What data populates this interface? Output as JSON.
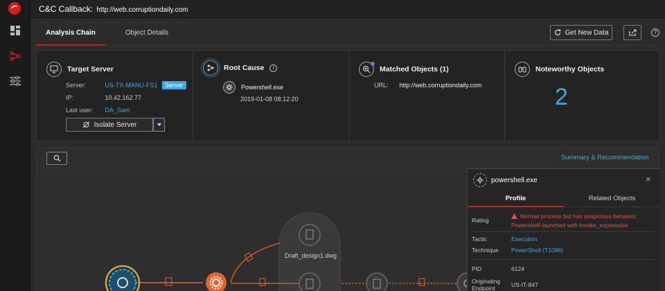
{
  "header": {
    "label": "C&C Callback:",
    "url": "http://web.corruptiondaily.com"
  },
  "tabs": [
    {
      "label": "Analysis Chain",
      "active": true
    },
    {
      "label": "Object Details",
      "active": false
    }
  ],
  "toolbar": {
    "get_new_data": "Get New Data"
  },
  "target_server": {
    "title": "Target Server",
    "server_label": "Server:",
    "server_value": "US-TX-MANU-FS1",
    "server_badge": "Server",
    "ip_label": "IP:",
    "ip_value": "10.42.162.77",
    "user_label": "Last user:",
    "user_value": "DA_Sam",
    "isolate_label": "Isolate Server"
  },
  "root_cause": {
    "title": "Root Cause",
    "process": "Powershell.exe",
    "timestamp": "2019-01-08 08:12:20"
  },
  "matched_objects": {
    "title": "Matched Objects (1)",
    "url_label": "URL:",
    "url_value": "http://web.corruptiondaily.com"
  },
  "noteworthy": {
    "title": "Noteworthy Objects",
    "count": "2"
  },
  "graph": {
    "summary_link": "Summary & Recommendation",
    "node_label": "Draft_design1.dwg"
  },
  "side_panel": {
    "title": "powershell.exe",
    "tabs": [
      {
        "label": "Profile",
        "active": true
      },
      {
        "label": "Related Objects",
        "active": false
      }
    ],
    "rating_label": "Rating",
    "rating_line1": "Normal process but has suspicious behavior:",
    "rating_line2": "Powershell launched with invoke_expression",
    "tactic_label": "Tactic",
    "tactic_value": "Execution",
    "technique_label": "Technique",
    "technique_value": "PowerShell (T1086)",
    "pid_label": "PID",
    "pid_value": "6124",
    "endpoint_label": "Originating Endpoint",
    "endpoint_value": "US-IT-847"
  },
  "colors": {
    "accent_red": "#d71920",
    "link_blue": "#3fa9e0",
    "warning": "#e8534a",
    "node_orange": "#e8622a"
  }
}
